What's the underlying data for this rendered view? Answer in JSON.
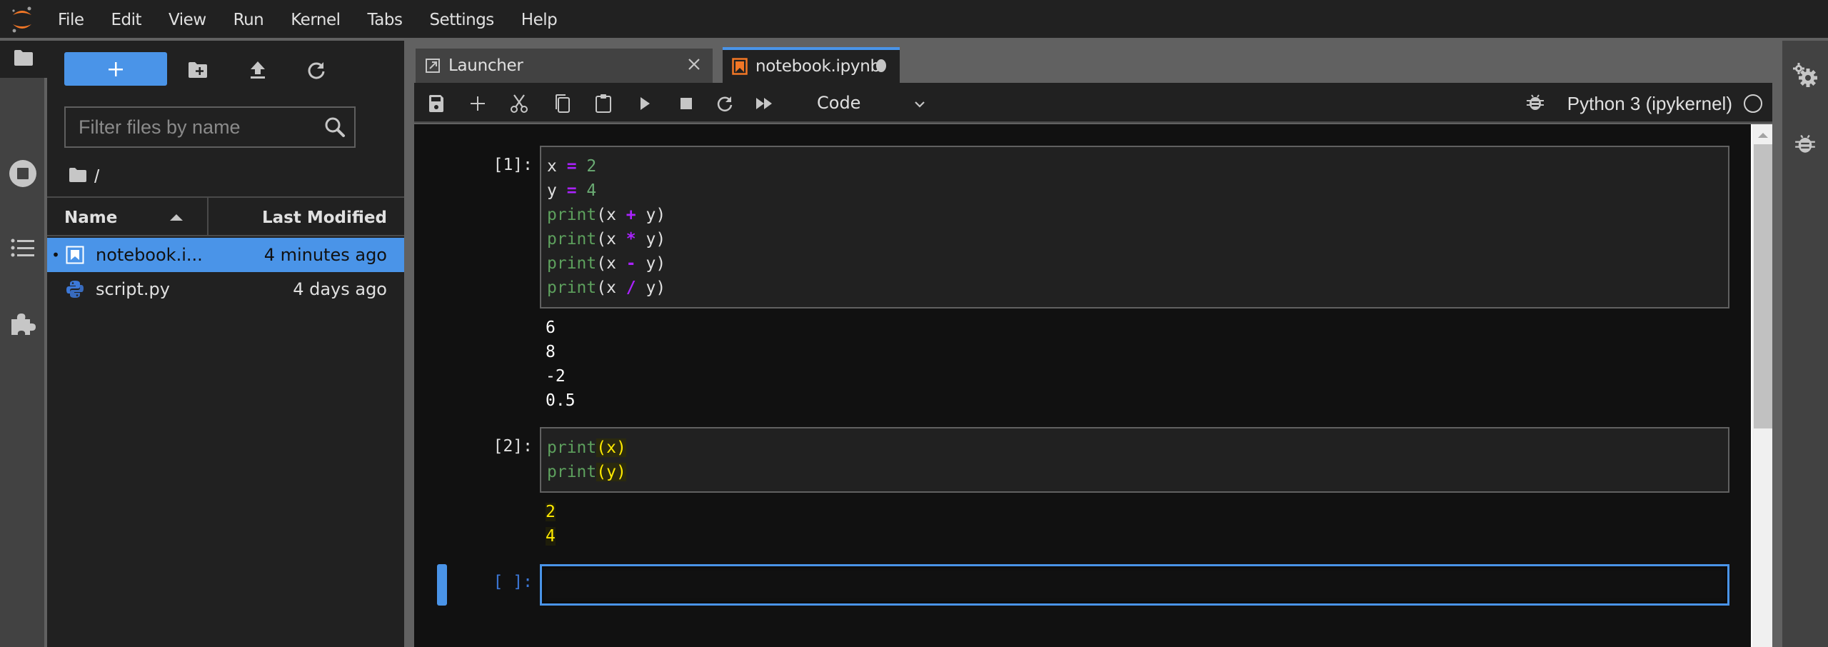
{
  "menubar": {
    "logo": "jupyter-logo-icon",
    "items": [
      "File",
      "Edit",
      "View",
      "Run",
      "Kernel",
      "Tabs",
      "Settings",
      "Help"
    ]
  },
  "left_sidebar": {
    "tabs": [
      {
        "name": "file-browser",
        "icon": "folder-icon",
        "active": true
      },
      {
        "name": "running-terminals-kernels",
        "icon": "stop-circle-icon",
        "active": false
      },
      {
        "name": "table-of-contents",
        "icon": "list-icon",
        "active": false
      },
      {
        "name": "extension-manager",
        "icon": "puzzle-icon",
        "active": false
      }
    ]
  },
  "file_browser": {
    "toolbar": {
      "new_launcher": "+",
      "new_folder": "new-folder-icon",
      "upload": "upload-icon",
      "refresh": "refresh-icon"
    },
    "filter": {
      "placeholder": "Filter files by name",
      "value": ""
    },
    "breadcrumb": "/",
    "columns": {
      "name": "Name",
      "last_modified": "Last Modified",
      "sort": "ascending"
    },
    "files": [
      {
        "name": "notebook.i...",
        "full_name": "notebook.ipynb",
        "modified": "4 minutes ago",
        "icon": "notebook-icon",
        "selected": true,
        "running": true
      },
      {
        "name": "script.py",
        "modified": "4 days ago",
        "icon": "python-icon",
        "selected": false,
        "running": false
      }
    ]
  },
  "tabs": [
    {
      "label": "Launcher",
      "icon": "launcher-icon",
      "active": false,
      "close": "×"
    },
    {
      "label": "notebook.ipynb",
      "icon": "notebook-icon",
      "active": true,
      "dirty": true
    }
  ],
  "notebook_toolbar": {
    "buttons": [
      "save",
      "insert-cell",
      "cut",
      "copy",
      "paste",
      "run",
      "interrupt",
      "restart",
      "restart-run-all"
    ],
    "cell_type": "Code",
    "kernel": "Python 3 (ipykernel)",
    "kernel_status": "idle"
  },
  "cells": [
    {
      "prompt": "[1]:",
      "source": [
        "x = 2",
        "y = 4",
        "print(x + y)",
        "print(x * y)",
        "print(x - y)",
        "print(x / y)"
      ],
      "outputs": [
        "6",
        "8",
        "-2",
        "0.5"
      ]
    },
    {
      "prompt": "[2]:",
      "source": [
        "print(x)",
        "print(y)"
      ],
      "outputs": [
        "2",
        "4"
      ]
    },
    {
      "prompt": "[ ]:",
      "source": [],
      "outputs": [],
      "active": true
    }
  ],
  "right_sidebar": {
    "tabs": [
      {
        "name": "property-inspector",
        "icon": "gears-icon"
      },
      {
        "name": "debugger",
        "icon": "bug-icon"
      }
    ]
  },
  "colors": {
    "accent": "#4a94e8",
    "background": "#111111",
    "panel": "#212121",
    "operator": "#aa22ff",
    "number": "#6aab73",
    "builtin": "#5da05d",
    "match_highlight": "#ffea00",
    "logo_orange": "#f37726"
  }
}
